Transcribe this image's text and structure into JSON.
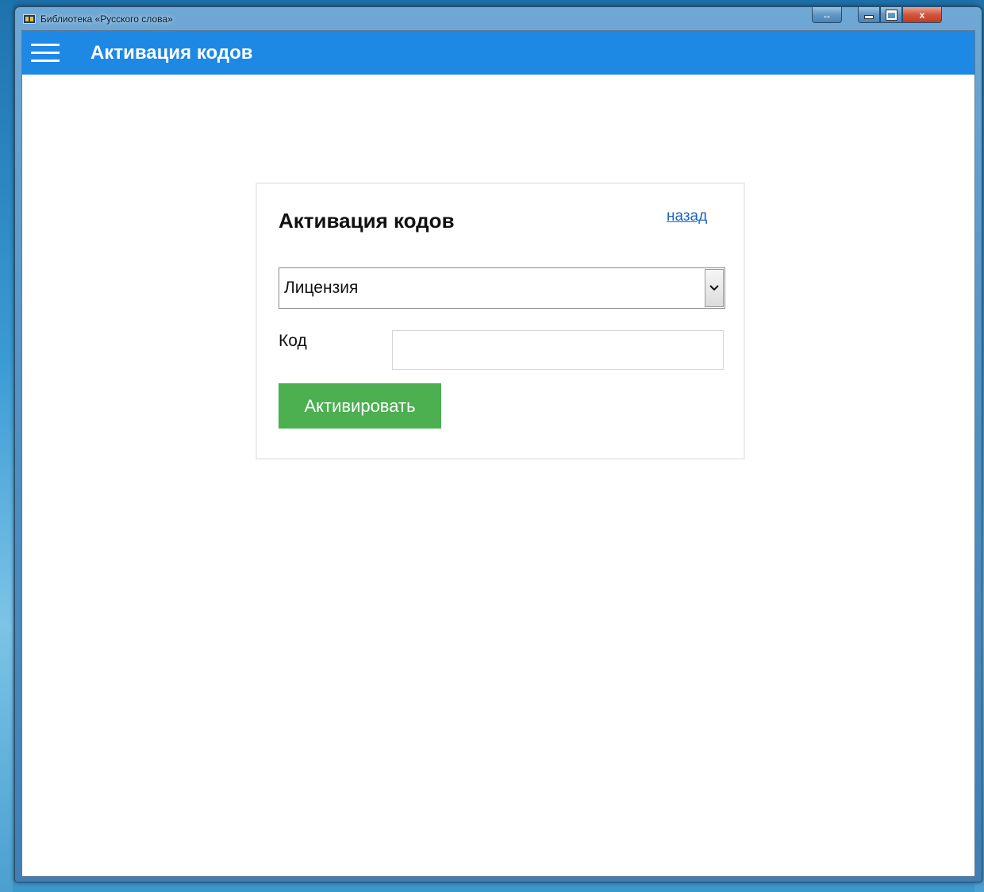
{
  "window": {
    "title": "Библиотека «Русского слова»",
    "controls": {
      "resize": "↔",
      "close": "x"
    }
  },
  "appbar": {
    "title": "Активация кодов"
  },
  "card": {
    "title": "Активация кодов",
    "back_link": "назад",
    "select": {
      "selected": "Лицензия"
    },
    "code": {
      "label": "Код",
      "value": "",
      "placeholder": ""
    },
    "activate_label": "Активировать"
  },
  "colors": {
    "appbar": "#1e88e5",
    "button": "#4caf50",
    "link": "#1a66c7"
  }
}
